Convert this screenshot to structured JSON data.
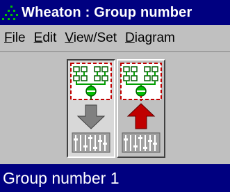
{
  "window": {
    "title": "Wheaton : Group number",
    "icon": "app-dots-icon"
  },
  "menu": {
    "items": [
      {
        "label": "File",
        "accel": "F",
        "rest": "ile"
      },
      {
        "label": "Edit",
        "accel": "E",
        "rest": "dit"
      },
      {
        "label": "View/Set",
        "accel": "V",
        "rest": "iew/Set"
      },
      {
        "label": "Diagram",
        "accel": "D",
        "rest": "iagram"
      }
    ]
  },
  "toolbar": {
    "buttons": [
      {
        "name": "move-down-button",
        "icon": "hierarchy-down-arrow-icon",
        "arrow_color": "#808080",
        "state": "pressed"
      },
      {
        "name": "move-up-button",
        "icon": "hierarchy-up-arrow-icon",
        "arrow_color": "#c00000",
        "state": "raised"
      }
    ]
  },
  "status": {
    "selection": "Group number 1"
  },
  "colors": {
    "titlebar": "#000080",
    "face": "#c0c0c0",
    "hierarchy": "#00a000",
    "dashed_frame": "#c00000"
  }
}
